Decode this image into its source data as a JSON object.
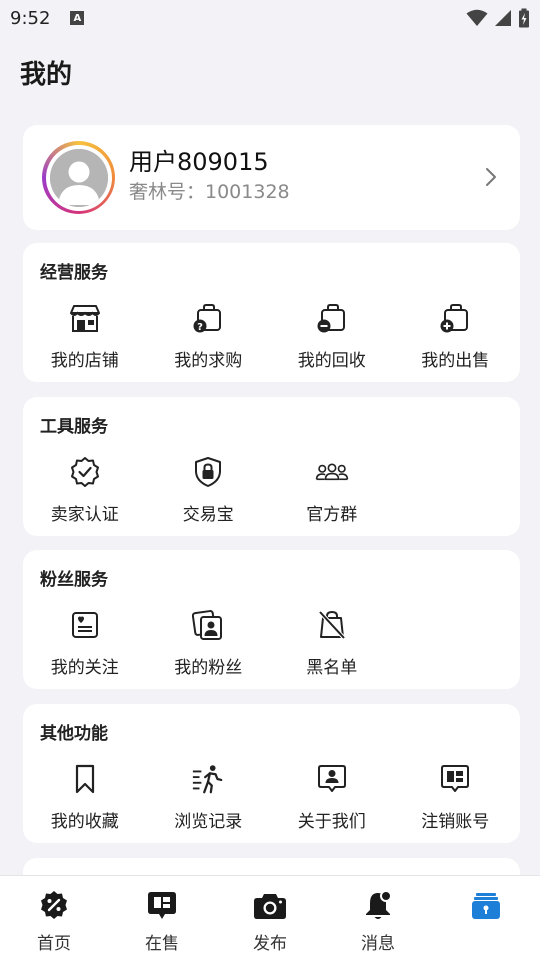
{
  "status_bar": {
    "time": "9:52",
    "notification_letter": "A"
  },
  "page": {
    "title": "我的"
  },
  "profile": {
    "name": "用户809015",
    "id_text": "奢林号：1001328"
  },
  "sections": [
    {
      "title": "经营服务",
      "items": [
        {
          "label": "我的店铺",
          "icon": "store-icon"
        },
        {
          "label": "我的求购",
          "icon": "bag-question-icon"
        },
        {
          "label": "我的回收",
          "icon": "bag-minus-icon"
        },
        {
          "label": "我的出售",
          "icon": "bag-plus-icon"
        }
      ]
    },
    {
      "title": "工具服务",
      "items": [
        {
          "label": "卖家认证",
          "icon": "verified-badge-icon"
        },
        {
          "label": "交易宝",
          "icon": "shield-lock-icon"
        },
        {
          "label": "官方群",
          "icon": "group-icon"
        }
      ]
    },
    {
      "title": "粉丝服务",
      "items": [
        {
          "label": "我的关注",
          "icon": "heart-card-icon"
        },
        {
          "label": "我的粉丝",
          "icon": "fans-photo-icon"
        },
        {
          "label": "黑名单",
          "icon": "blocked-bag-icon"
        }
      ]
    },
    {
      "title": "其他功能",
      "items": [
        {
          "label": "我的收藏",
          "icon": "bookmark-icon"
        },
        {
          "label": "浏览记录",
          "icon": "walking-icon"
        },
        {
          "label": "关于我们",
          "icon": "user-chat-icon"
        },
        {
          "label": "注销账号",
          "icon": "chat-grid-icon"
        }
      ]
    }
  ],
  "tabbar": {
    "items": [
      {
        "label": "首页",
        "icon": "discount-badge-icon"
      },
      {
        "label": "在售",
        "icon": "chat-box-icon"
      },
      {
        "label": "发布",
        "icon": "camera-icon"
      },
      {
        "label": "消息",
        "icon": "bell-icon"
      },
      {
        "label": "",
        "icon": "wallet-icon"
      }
    ],
    "active_color": "#1e7fd8"
  }
}
